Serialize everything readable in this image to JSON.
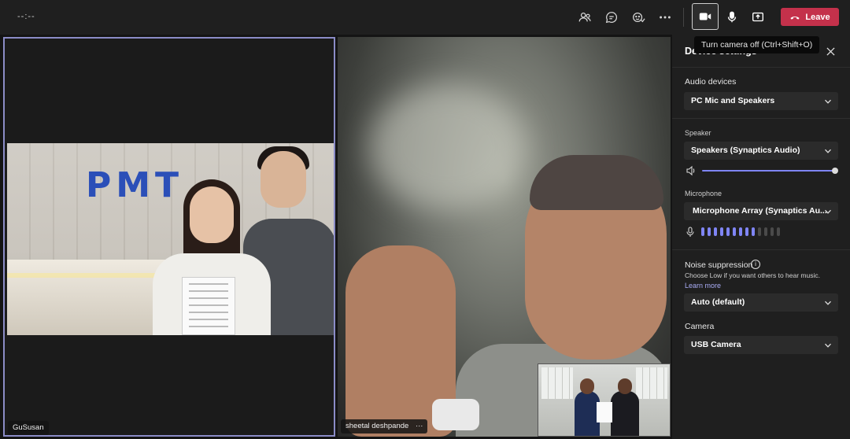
{
  "topbar": {
    "timer": "--:--",
    "leave_label": "Leave",
    "icons": [
      "people-icon",
      "chat-icon",
      "reactions-icon",
      "more-icon",
      "camera-icon",
      "mic-icon",
      "share-icon",
      "phone-icon"
    ]
  },
  "tooltip": "Turn camera off (Ctrl+Shift+O)",
  "tiles": {
    "left": {
      "name": "GuSusan",
      "logo_text": "PMT"
    },
    "right": {
      "name": "sheetal deshpande",
      "more": "···"
    }
  },
  "panel": {
    "title": "Device settings",
    "audio_devices_label": "Audio devices",
    "audio_devices_value": "PC Mic and Speakers",
    "speaker_label": "Speaker",
    "speaker_value": "Speakers (Synaptics Audio)",
    "speaker_volume": 1.0,
    "microphone_label": "Microphone",
    "microphone_value": "Microphone Array (Synaptics Au...",
    "mic_level_bars": 9,
    "mic_total_bars": 13,
    "noise_label": "Noise suppression",
    "noise_desc": "Choose Low if you want others to hear music.",
    "learn_more": "Learn more",
    "noise_value": "Auto (default)",
    "camera_label": "Camera",
    "camera_value": "USB Camera"
  },
  "colors": {
    "accent": "#7f85f5",
    "leave": "#c4314b",
    "active_border": "#8b8cc7"
  }
}
